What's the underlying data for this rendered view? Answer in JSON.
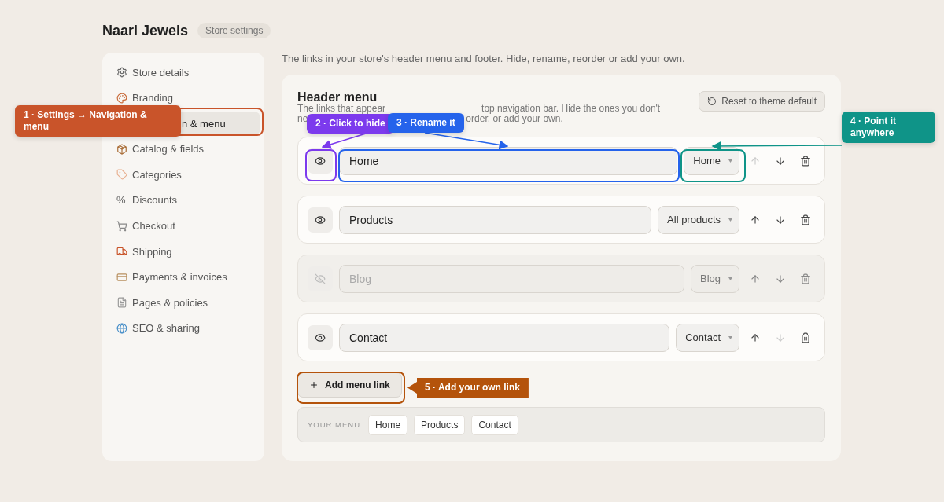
{
  "store": {
    "name": "Naari Jewels",
    "badge": "Store settings"
  },
  "sidebar": {
    "items": [
      {
        "label": "Store details",
        "selected": false
      },
      {
        "label": "Branding",
        "selected": false
      },
      {
        "label": "n & menu",
        "selected": true
      },
      {
        "label": "Catalog & fields",
        "selected": false
      },
      {
        "label": "Categories",
        "selected": false
      },
      {
        "label": "Discounts",
        "selected": false,
        "glyph": "%"
      },
      {
        "label": "Checkout",
        "selected": false
      },
      {
        "label": "Shipping",
        "selected": false
      },
      {
        "label": "Payments & invoices",
        "selected": false
      },
      {
        "label": "Pages & policies",
        "selected": false
      },
      {
        "label": "SEO & sharing",
        "selected": false
      }
    ]
  },
  "intro": "The links in your store's header menu and footer. Hide, rename, reorder or add your own.",
  "panel": {
    "title": "Header menu",
    "description": [
      "The links that appear",
      "top navigation bar. Hide the ones you don't",
      "ne",
      "order, or add your own."
    ],
    "reset_button": "Reset to theme default",
    "rows": [
      {
        "label": "Home",
        "target": "Home",
        "hidden": false,
        "up_disabled": true,
        "down_disabled": false
      },
      {
        "label": "Products",
        "target": "All products",
        "hidden": false,
        "up_disabled": false,
        "down_disabled": false
      },
      {
        "label": "Blog",
        "target": "Blog",
        "hidden": true,
        "up_disabled": false,
        "down_disabled": false
      },
      {
        "label": "Contact",
        "target": "Contact",
        "hidden": false,
        "up_disabled": false,
        "down_disabled": true
      }
    ],
    "add_button": "Add menu link",
    "preview": {
      "label": "YOUR MENU",
      "chips": [
        "Home",
        "Products",
        "Contact"
      ]
    }
  },
  "annotations": [
    {
      "text": "1 · Settings → Navigation & menu",
      "color": "#c9542a"
    },
    {
      "text": "2 · Click to hide",
      "color": "#7c3aed"
    },
    {
      "text": "3 · Rename it",
      "color": "#2563eb"
    },
    {
      "text": "4 · Point it anywhere",
      "color": "#0f9488"
    },
    {
      "text": "5 · Add your own link",
      "color": "#b4530b"
    }
  ]
}
